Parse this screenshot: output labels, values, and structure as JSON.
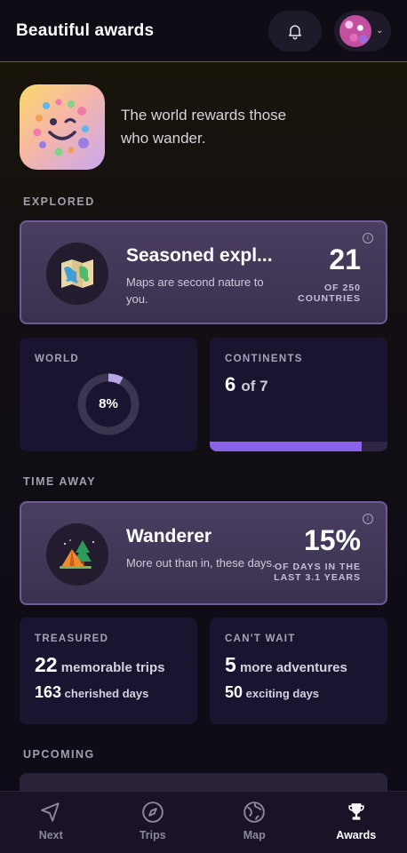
{
  "header": {
    "title": "Beautiful awards"
  },
  "intro": {
    "tagline": "The world rewards those who wander."
  },
  "explored": {
    "section_label": "EXPLORED",
    "card": {
      "title": "Seasoned expl...",
      "description": "Maps are second nature to you.",
      "value": "21",
      "sub_line1": "OF 250",
      "sub_line2": "COUNTRIES",
      "info": "i"
    },
    "world": {
      "label": "WORLD",
      "percent_text": "8%",
      "percent": 8
    },
    "continents": {
      "label": "CONTINENTS",
      "value": "6",
      "of_text": "of 7",
      "fraction": 0.857
    }
  },
  "time_away": {
    "section_label": "TIME AWAY",
    "card": {
      "title": "Wanderer",
      "description": "More out than in, these days.",
      "value": "15%",
      "sub_line1": "OF DAYS IN THE",
      "sub_line2": "LAST 3.1 YEARS",
      "info": "i"
    },
    "treasured": {
      "label": "TREASURED",
      "trips_num": "22",
      "trips_text": "memorable trips",
      "days_num": "163",
      "days_text": "cherished days"
    },
    "cant_wait": {
      "label": "CAN'T WAIT",
      "trips_num": "5",
      "trips_text": "more adventures",
      "days_num": "50",
      "days_text": "exciting days"
    }
  },
  "upcoming": {
    "section_label": "UPCOMING"
  },
  "nav": [
    {
      "label": "Next",
      "icon": "navigation-arrow-icon",
      "active": false
    },
    {
      "label": "Trips",
      "icon": "compass-icon",
      "active": false
    },
    {
      "label": "Map",
      "icon": "globe-icon",
      "active": false
    },
    {
      "label": "Awards",
      "icon": "trophy-icon",
      "active": true
    }
  ],
  "colors": {
    "accent": "#8a62e6",
    "card_border": "#6e5a94",
    "tile_bg": "#1b1430"
  }
}
